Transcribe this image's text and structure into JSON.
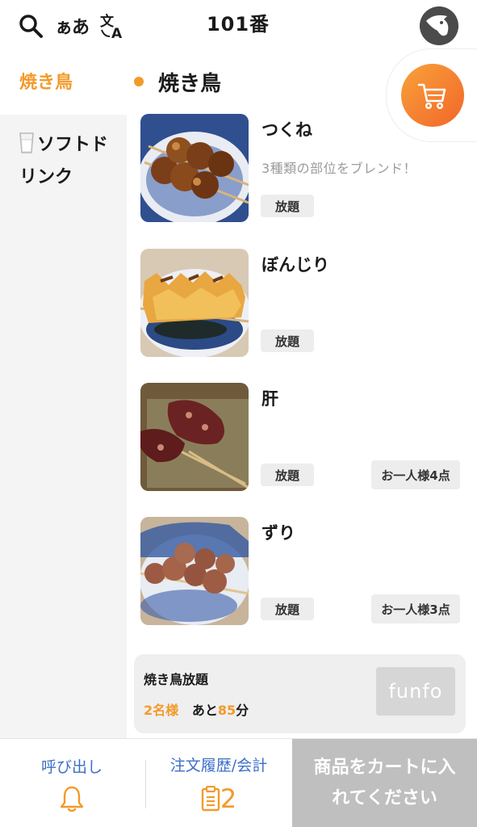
{
  "header": {
    "table_name": "101番",
    "language_label": "ぁあ"
  },
  "sidebar": {
    "items": [
      {
        "label": "焼き鳥"
      },
      {
        "label": "ソフトドリンク"
      }
    ]
  },
  "category": {
    "title": "焼き鳥"
  },
  "items": [
    {
      "name": "つくね",
      "description": "3種類の部位をブレンド！",
      "plan_tag": "放題",
      "limit_tag": "",
      "icon": "tsukune-photo"
    },
    {
      "name": "ぼんじり",
      "description": "",
      "plan_tag": "放題",
      "limit_tag": "",
      "icon": "bonjiri-photo"
    },
    {
      "name": "肝",
      "description": "",
      "plan_tag": "放題",
      "limit_tag": "お一人様4点",
      "icon": "liver-photo"
    },
    {
      "name": "ずり",
      "description": "",
      "plan_tag": "放題",
      "limit_tag": "お一人様3点",
      "icon": "gizzard-photo"
    }
  ],
  "plan": {
    "title": "焼き鳥放題",
    "people": "2名様",
    "remaining_prefix": "あと",
    "remaining_minutes": "85",
    "minutes_unit": "分",
    "logo_text": "funfo"
  },
  "footer": {
    "call_label": "呼び出し",
    "history_label": "注文履歴/会計",
    "history_count": "2",
    "cta_label": "商品をカートに入れてください"
  },
  "colors": {
    "accent": "#f39a2a",
    "link": "#3d6ec7",
    "cart_gradient": [
      "#f8a23a",
      "#f2662a"
    ],
    "cta_disabled": "#bfbfbf"
  }
}
